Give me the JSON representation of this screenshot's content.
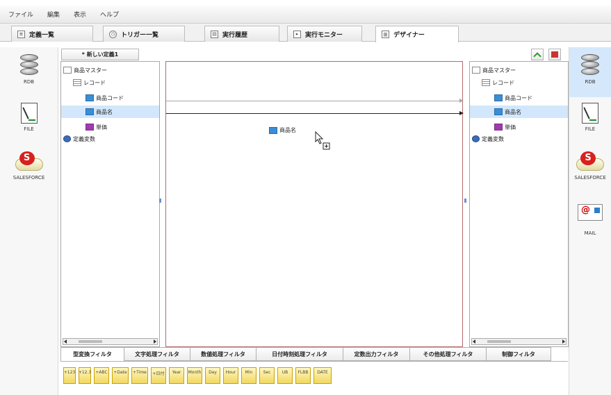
{
  "menu": [
    "ファイル",
    "編集",
    "表示",
    "ヘルプ"
  ],
  "tabs": [
    {
      "label": "定義一覧",
      "icon": "list-icon"
    },
    {
      "label": "トリガー一覧",
      "icon": "clock-icon"
    },
    {
      "label": "実行履歴",
      "icon": "history-icon"
    },
    {
      "label": "実行モニター",
      "icon": "monitor-icon"
    },
    {
      "label": "デザイナー",
      "icon": "designer-icon",
      "active": true
    }
  ],
  "left_palette": [
    {
      "label": "RDB",
      "icon": "database-icon"
    },
    {
      "label": "FILE",
      "icon": "file-icon"
    },
    {
      "label": "SALESFORCE",
      "icon": "salesforce-icon"
    }
  ],
  "right_palette": [
    {
      "label": "RDB",
      "icon": "database-icon",
      "selected": true
    },
    {
      "label": "FILE",
      "icon": "file-icon"
    },
    {
      "label": "SALESFORCE",
      "icon": "salesforce-icon"
    },
    {
      "label": "MAIL",
      "icon": "mail-icon"
    }
  ],
  "new_definition_label": "* 新しい定義1",
  "source_tree": [
    {
      "label": "商品マスター",
      "icon": "table-icon"
    },
    {
      "label": "レコード",
      "icon": "record-icon"
    },
    {
      "label": "商品コード",
      "icon": "field-blue-icon"
    },
    {
      "label": "商品名",
      "icon": "field-blue-icon",
      "selected": true
    },
    {
      "label": "単価",
      "icon": "field-purple-icon"
    },
    {
      "label": "定義変数",
      "icon": "variable-icon"
    }
  ],
  "target_tree": [
    {
      "label": "商品マスター",
      "icon": "table-icon"
    },
    {
      "label": "レコード",
      "icon": "record-icon"
    },
    {
      "label": "商品コード",
      "icon": "field-blue-icon"
    },
    {
      "label": "商品名",
      "icon": "field-blue-icon",
      "selected": true
    },
    {
      "label": "単価",
      "icon": "field-purple-icon"
    },
    {
      "label": "定義変数",
      "icon": "variable-icon"
    }
  ],
  "drag_node_label": "商品名",
  "filter_tabs": [
    "型変換フィルタ",
    "文字処理フィルタ",
    "数値処理フィルタ",
    "日付時刻処理フィルタ",
    "定数出力フィルタ",
    "その他処理フィルタ",
    "制御フィルタ"
  ],
  "filter_buttons": [
    "+123",
    "+12.3",
    "+ABC",
    "+Date",
    "+Time",
    "+日付",
    "Year",
    "Month",
    "Day",
    "Hour",
    "Min",
    "Sec",
    "UB",
    "FLBB",
    "DATE"
  ],
  "colors": {
    "accent_selected": "#d2e7fb",
    "canvas_border": "#b46a6a",
    "filter_button": "#f1d860"
  }
}
